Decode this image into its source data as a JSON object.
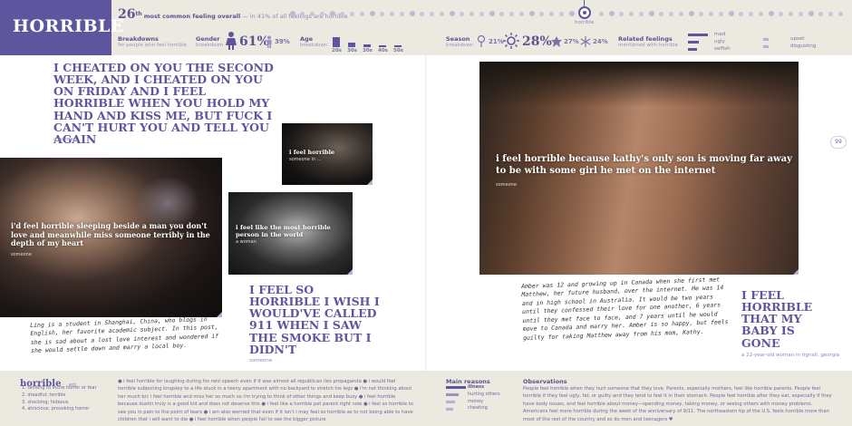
{
  "logo": "HORRIBLE",
  "rank": {
    "number": "26",
    "suffix": "th",
    "text": "most common feeling overall",
    "sub": "— in 41% of all feelings are horrible",
    "marker_label": "horrible"
  },
  "breakdowns": {
    "title": "Breakdowns",
    "sub": "for people who feel horrible"
  },
  "gender": {
    "title": "Gender",
    "sub": "breakdown",
    "female_pct": "61%",
    "male_pct": "39%"
  },
  "age": {
    "title": "Age",
    "sub": "breakdown",
    "labels": [
      "20s",
      "30s",
      "30s",
      "40s",
      "50s"
    ],
    "values": [
      0.8,
      0.35,
      0.2,
      0.15,
      0.15
    ]
  },
  "season": {
    "title": "Season",
    "sub": "breakdown",
    "values": [
      "21%",
      "28%",
      "27%",
      "24%"
    ]
  },
  "related": {
    "title": "Related feelings",
    "sub": "mentioned with horrible",
    "col1": [
      "mad",
      "ugly",
      "selfish"
    ],
    "col2": [
      "upset",
      "disgusting"
    ]
  },
  "quotes": {
    "q1": {
      "text": "I cheated on you the second week, and I cheated on you on friday and I feel horrible when you hold my hand and kiss me, but fuck I can't hurt you and tell you again",
      "attrib": "a woman"
    },
    "q2": {
      "text": "i feel horrible",
      "attrib": "someone in ..."
    },
    "q3": {
      "text": "i'd feel horrible sleeping beside a man you don't love and meanwhile miss someone terribly in the depth of my heart",
      "attrib": "someone"
    },
    "q4": {
      "text": "i feel like the most horrible person in the world",
      "attrib": "a woman"
    },
    "q5": {
      "text": "I feel so horrible I wish I would've called 911 when I saw the smoke but I didn't",
      "attrib": "someone"
    },
    "q6": {
      "text": "i feel horrible because kathy's only son is moving far away to be with some girl he met on the internet",
      "attrib": "someone"
    },
    "q7": {
      "text": "I feel horrible that my baby is gone",
      "attrib": "a 22-year-old woman in tignall, georgia"
    }
  },
  "notes": {
    "ling": "Ling is a student in Shanghai, China, who blogs in English, her favorite academic subject. In this post, she is sad about a lost love interest and wondered if she would settle down and marry a local boy.",
    "amber": "Amber was 12 and growing up in Canada when she first met Matthew, her future husband, over the internet. He was 14 and in high school in Australia. It would be two years until they confessed their love for one another, 6 years until they met face to face, and 7 years until he would move to Canada and marry her. Amber is so happy, but feels guilty for taking Matthew away from his mom, Kathy."
  },
  "page_number": "99",
  "footer": {
    "word": "horrible",
    "pos": "adj.",
    "definitions": [
      "1. tending to incite horror or fear",
      "2. dreadful; terrible",
      "3. shocking; hideous",
      "4. atrocious; provoking horror"
    ],
    "feed": "● i feel horrible for laughing during his rant speech even if it was almost all republican lies propaganda ● i would feel horrible subjecting kingsley to a life stuck in a teeny apartment with no backyard to stretch his legs ● i'm not thinking about her much b/c i feel horrible and miss her so much so i'm trying to think of other things and keep busy ● i feel horrible because dustin truly is a good kid and does not deserve this ● i feel like a horrible pet parent right now ● i feel so horrible to see you in pain to the point of tears ● i am also worried that even if it isn't i may feel so horrible as to not being able to have children that i will want to die ● i feel horrible when people fail to see the bigger picture",
    "reasons_title": "Main reasons",
    "reasons": [
      "illness",
      "hurting others",
      "money",
      "cheating"
    ],
    "obs_title": "Observations",
    "observations": "People feel horrible when they hurt someone that they love. Parents, especially mothers, feel like horrible parents. People feel horrible if they feel ugly, fat, or guilty and they tend to feel it in their stomach. People feel horrible after they eat, especially if they have body issues, and feel horrible about money—spending money, taking money, or seeing others with money problems. Americans feel more horrible during the week of the anniversary of 9/11. The northeastern tip of the U.S. feels horrible more than most of the rest of the country and so do men and teenagers ♥"
  },
  "colors": {
    "accent": "#5d569e",
    "band": "#ece9e0"
  }
}
